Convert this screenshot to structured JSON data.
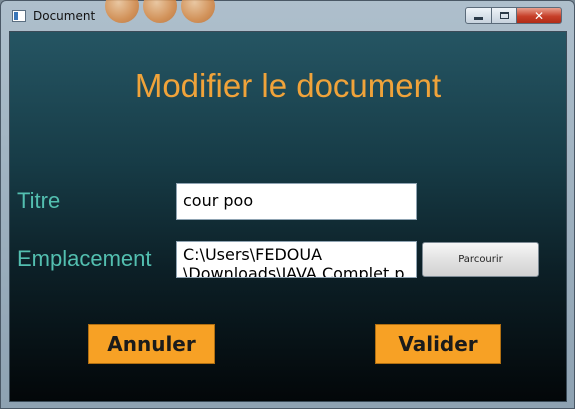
{
  "window": {
    "title": "Document",
    "controls": {
      "minimize_icon": "minimize-icon",
      "maximize_icon": "maximize-icon",
      "close_icon": "close-icon",
      "close_glyph": "✕"
    }
  },
  "form": {
    "heading": "Modifier le document",
    "title_label": "Titre",
    "title_value": "cour poo",
    "location_label": "Emplacement",
    "location_value": "C:\\Users\\FEDOUA\n\\Downloads\\JAVA Complet.pdf",
    "browse_label": "Parcourir"
  },
  "actions": {
    "cancel_label": "Annuler",
    "submit_label": "Valider"
  },
  "colors": {
    "heading": "#f0a33a",
    "label": "#53bfb0",
    "action_button": "#f7a125"
  }
}
